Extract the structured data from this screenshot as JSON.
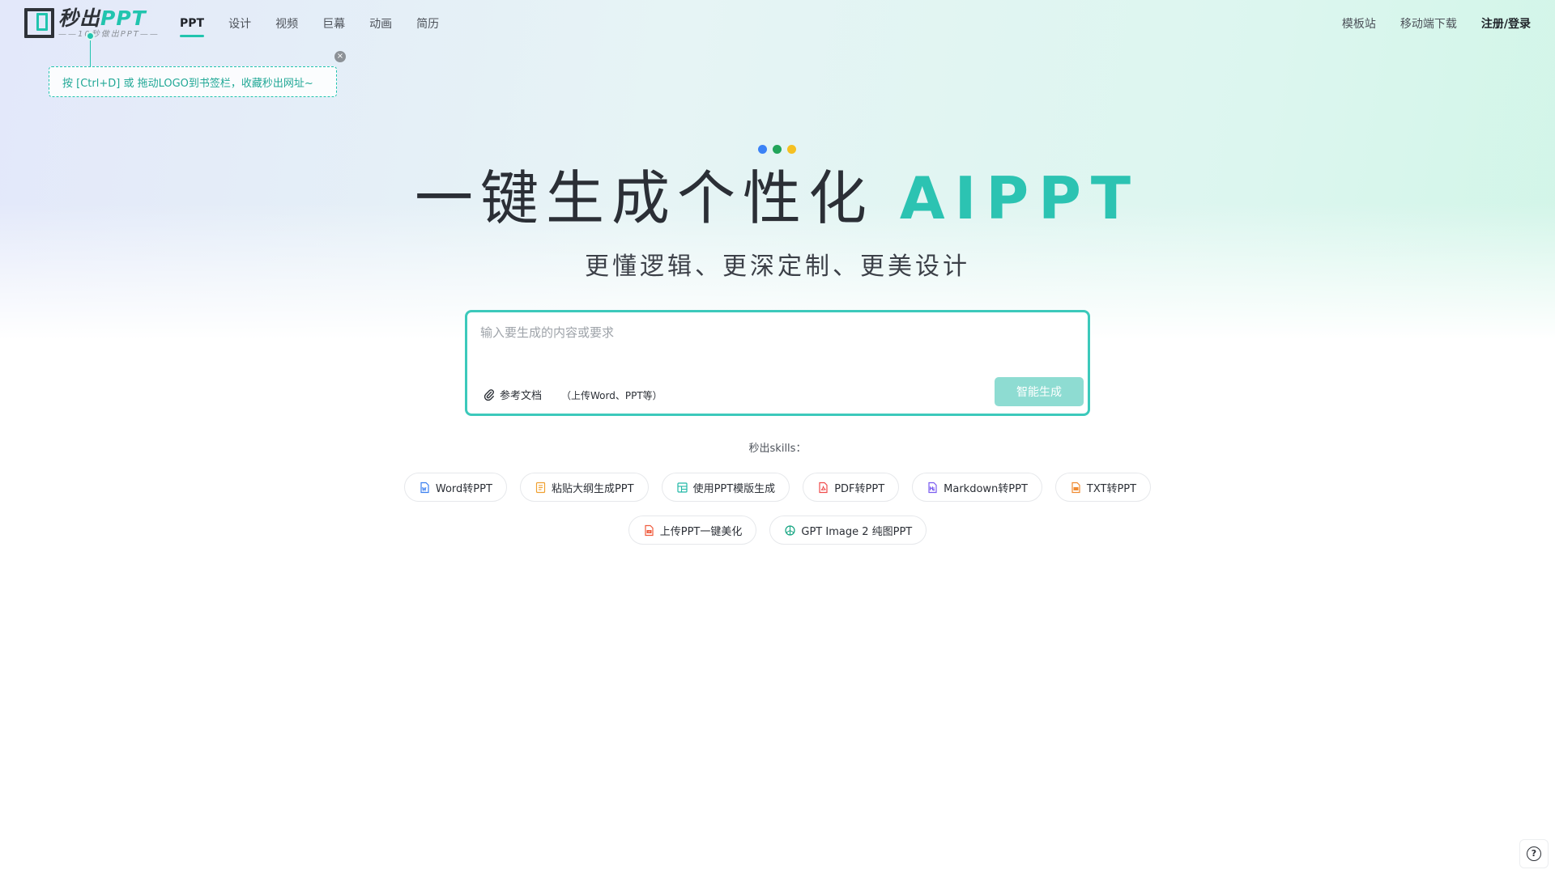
{
  "logo": {
    "title_cn": "秒出",
    "title_en": "PPT",
    "subtitle": "——10秒做出PPT——"
  },
  "nav": {
    "items": [
      {
        "label": "PPT",
        "active": true
      },
      {
        "label": "设计",
        "active": false
      },
      {
        "label": "视频",
        "active": false
      },
      {
        "label": "巨幕",
        "active": false
      },
      {
        "label": "动画",
        "active": false
      },
      {
        "label": "简历",
        "active": false
      }
    ]
  },
  "header_right": {
    "template_site": "模板站",
    "mobile_download": "移动端下载",
    "login": "注册/登录"
  },
  "tip": {
    "text": "按 [Ctrl+D] 或 拖动LOGO到书签栏，收藏秒出网址~",
    "close": "×"
  },
  "hero": {
    "title_main": "一键生成个性化",
    "title_accent": "AIPPT",
    "subtitle": "更懂逻辑、更深定制、更美设计",
    "dot_colors": [
      "#3b82f6",
      "#22a55a",
      "#f5c022"
    ]
  },
  "input": {
    "placeholder": "输入要生成的内容或要求",
    "value": "",
    "ref_doc_label": "参考文档",
    "ref_doc_note": "（上传Word、PPT等）",
    "generate_label": "智能生成"
  },
  "skills": {
    "title": "秒出skills：",
    "row1": [
      {
        "label": "Word转PPT",
        "icon": "word-doc-icon",
        "color": "#3b7ff0"
      },
      {
        "label": "粘贴大纲生成PPT",
        "icon": "outline-doc-icon",
        "color": "#f0a030"
      },
      {
        "label": "使用PPT模版生成",
        "icon": "template-grid-icon",
        "color": "#21b8a6"
      },
      {
        "label": "PDF转PPT",
        "icon": "pdf-doc-icon",
        "color": "#ef4b4b"
      },
      {
        "label": "Markdown转PPT",
        "icon": "markdown-doc-icon",
        "color": "#7a5cf0"
      },
      {
        "label": "TXT转PPT",
        "icon": "txt-doc-icon",
        "color": "#f08a30"
      }
    ],
    "row2": [
      {
        "label": "上传PPT一键美化",
        "icon": "ppt-beautify-icon",
        "color": "#ef5a3c"
      },
      {
        "label": "GPT Image 2 纯图PPT",
        "icon": "openai-logo-icon",
        "color": "#10a37f"
      }
    ]
  },
  "colors": {
    "accent": "#21c4ae",
    "button_disabled": "#8edcd2",
    "input_border": "#3cc9bb"
  }
}
